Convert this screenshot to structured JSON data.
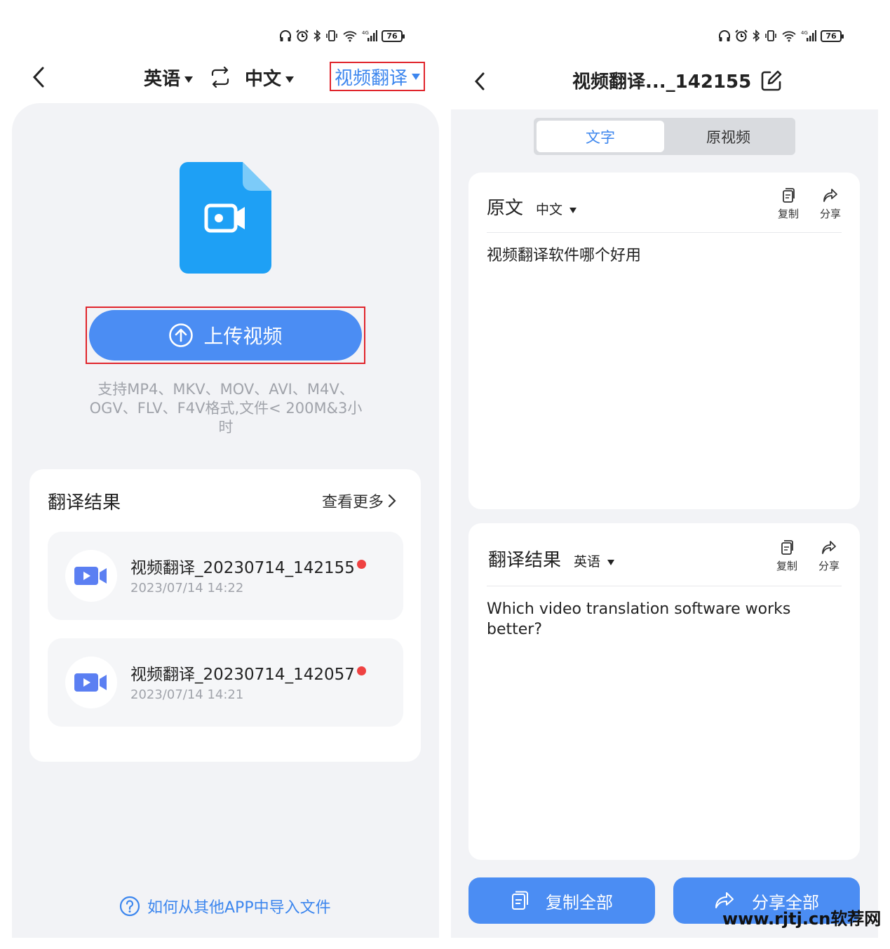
{
  "status_bar": {
    "battery": "76"
  },
  "left": {
    "source_lang": "英语",
    "target_lang": "中文",
    "mode": "视频翻译",
    "upload_label": "上传视频",
    "formats_line1": "支持MP4、MKV、MOV、AVI、M4V、",
    "formats_line2": "OGV、FLV、F4V格式,文件< 200M&3小",
    "formats_line3": "时",
    "results": {
      "title": "翻译结果",
      "see_more": "查看更多",
      "items": [
        {
          "name": "视频翻译_20230714_142155",
          "date": "2023/07/14 14:22"
        },
        {
          "name": "视频翻译_20230714_142057",
          "date": "2023/07/14 14:21"
        }
      ]
    },
    "help": "如何从其他APP中导入文件"
  },
  "right": {
    "title": "视频翻译..._142155",
    "tabs": {
      "text": "文字",
      "video": "原视频"
    },
    "original": {
      "title": "原文",
      "lang": "中文",
      "copy": "复制",
      "share": "分享",
      "text": "视频翻译软件哪个好用"
    },
    "translation": {
      "title": "翻译结果",
      "lang": "英语",
      "copy": "复制",
      "share": "分享",
      "text": "Which video translation software works better?"
    },
    "copy_all": "复制全部",
    "share_all": "分享全部"
  },
  "watermark": "www.rjtj.cn软荐网",
  "colors": {
    "accent": "#4b8df3",
    "link": "#3c86ee",
    "panel_bg": "#f2f3f6",
    "highlight": "#e0242b",
    "unread": "#ef4242"
  }
}
